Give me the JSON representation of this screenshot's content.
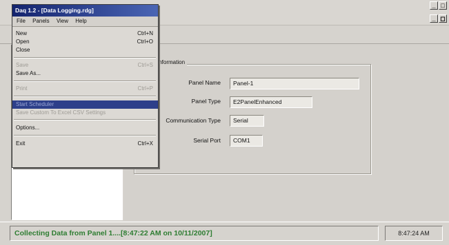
{
  "window": {
    "title": "Daq 1.2 - [Data Logging.rdg]"
  },
  "menubar": [
    "File",
    "Panels",
    "View",
    "Help"
  ],
  "file_menu": {
    "items": [
      {
        "label": "New",
        "shortcut": "Ctrl+N",
        "enabled": true
      },
      {
        "label": "Open",
        "shortcut": "Ctrl+O",
        "enabled": true
      },
      {
        "label": "Close",
        "shortcut": "",
        "enabled": true
      },
      {
        "label": "Save",
        "shortcut": "Ctrl+S",
        "enabled": false
      },
      {
        "label": "Save As...",
        "shortcut": "",
        "enabled": true
      },
      {
        "label": "Print",
        "shortcut": "Ctrl+P",
        "enabled": false
      },
      {
        "label": "Start Scheduler",
        "shortcut": "",
        "enabled": false,
        "selected": true
      },
      {
        "label": "Save Custom To Excel CSV Settings",
        "shortcut": "",
        "enabled": false
      },
      {
        "label": "Options...",
        "shortcut": "",
        "enabled": true
      },
      {
        "label": "Exit",
        "shortcut": "Ctrl+X",
        "enabled": true
      }
    ]
  },
  "panel_info": {
    "group_title": "Information",
    "fields": [
      {
        "label": "Panel Name",
        "value": "Panel-1"
      },
      {
        "label": "Panel Type",
        "value": "E2PanelEnhanced"
      },
      {
        "label": "Communication Type",
        "value": "Serial"
      },
      {
        "label": "Serial Port",
        "value": "COM1"
      }
    ]
  },
  "status": {
    "message": "Collecting Data from Panel 1....[8:47:22 AM on 10/11/2007]",
    "time": "8:47:24 AM"
  },
  "colors": {
    "title_bar": "#1a2a78",
    "status_text": "#2e7d32",
    "selected_item": "#2d3f8a"
  }
}
